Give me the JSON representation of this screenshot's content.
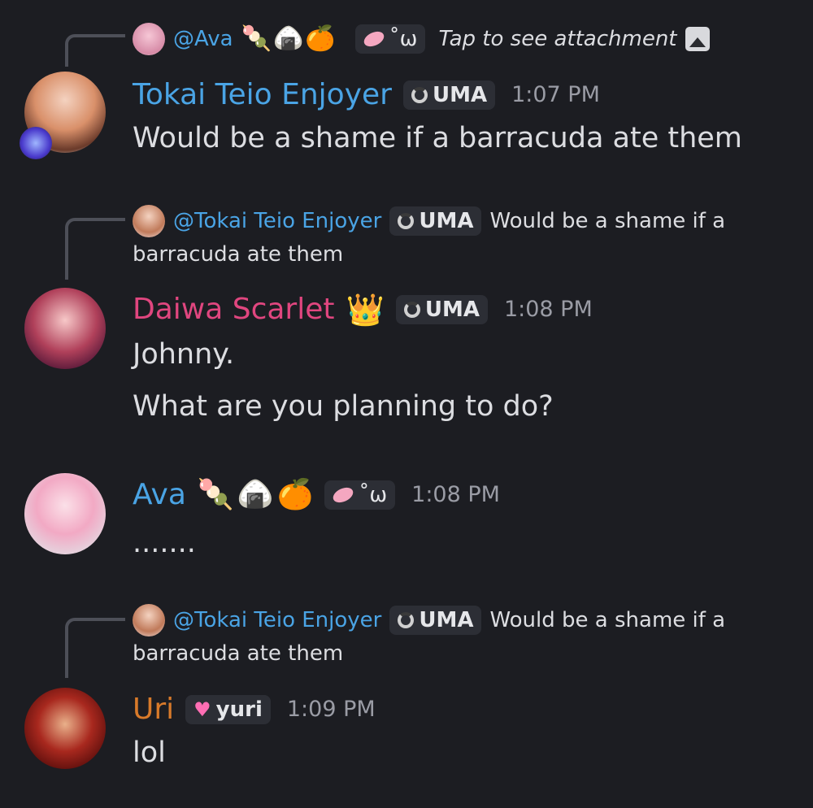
{
  "colors": {
    "background": "#1c1d22",
    "mention": "#4aa4e5",
    "tokai_name": "#4aa4e5",
    "daiwa_name": "#e0467f",
    "ava_name": "#4aa4e5",
    "uri_name": "#d87a2a"
  },
  "messages": [
    {
      "reply": {
        "mention": "@Ava",
        "emojis": [
          "🍡",
          "🍙",
          "🍊"
        ],
        "tag_text": "˚ω",
        "text": "Tap to see attachment",
        "icon": "image-icon"
      },
      "author": "Tokai Teio Enjoyer",
      "tag": "UMA",
      "time": "1:07 PM",
      "lines": [
        "Would be a shame if a barracuda ate them"
      ]
    },
    {
      "reply": {
        "mention": "@Tokai Teio Enjoyer",
        "tag": "UMA",
        "text_line1": "Would be a shame if a",
        "text_line2": "barracuda ate them"
      },
      "author": "Daiwa Scarlet",
      "author_emoji": "👑",
      "tag": "UMA",
      "time": "1:08 PM",
      "lines": [
        "Johnny.",
        "What are you planning to do?"
      ]
    },
    {
      "author": "Ava",
      "emojis": [
        "🍡",
        "🍙",
        "🍊"
      ],
      "tag_text": "˚ω",
      "time": "1:08 PM",
      "lines": [
        "......."
      ]
    },
    {
      "reply": {
        "mention": "@Tokai Teio Enjoyer",
        "tag": "UMA",
        "text_line1": "Would be a shame if a",
        "text_line2": "barracuda ate them"
      },
      "author": "Uri",
      "tag": "yuri",
      "time": "1:09 PM",
      "lines": [
        "lol"
      ]
    }
  ]
}
